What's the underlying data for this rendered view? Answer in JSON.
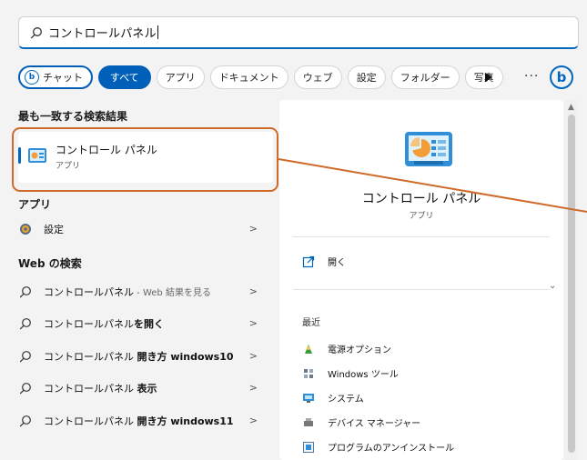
{
  "search": {
    "query": "コントロールパネル"
  },
  "filters": [
    {
      "label": "チャット"
    },
    {
      "label": "すべて"
    },
    {
      "label": "アプリ"
    },
    {
      "label": "ドキュメント"
    },
    {
      "label": "ウェブ"
    },
    {
      "label": "設定"
    },
    {
      "label": "フォルダー"
    },
    {
      "label": "写真"
    }
  ],
  "more_label": "···",
  "left": {
    "best_match_title": "最も一致する検索結果",
    "best_match": {
      "title": "コントロール パネル",
      "subtitle": "アプリ"
    },
    "apps_title": "アプリ",
    "apps": [
      {
        "label": "設定"
      }
    ],
    "web_title": "Web の検索",
    "web": [
      {
        "plain": "コントロールパネル",
        "muted": " - Web 結果を見る",
        "bold": ""
      },
      {
        "plain": "コントロールパネル",
        "muted": "",
        "bold": "を開く"
      },
      {
        "plain": "コントロールパネル ",
        "muted": "",
        "bold": "開き方 windows10"
      },
      {
        "plain": "コントロールパネル ",
        "muted": "",
        "bold": "表示"
      },
      {
        "plain": "コントロールパネル ",
        "muted": "",
        "bold": "開き方 windows11"
      }
    ]
  },
  "right": {
    "title": "コントロール パネル",
    "subtitle": "アプリ",
    "open_label": "開く",
    "recent_title": "最近",
    "recent": [
      {
        "label": "電源オプション"
      },
      {
        "label": "Windows ツール"
      },
      {
        "label": "システム"
      },
      {
        "label": "デバイス マネージャー"
      },
      {
        "label": "プログラムのアンインストール"
      }
    ]
  },
  "colors": {
    "accent": "#0067c0",
    "annotation": "#cf6a28",
    "selected_chip": "#005fb8"
  }
}
